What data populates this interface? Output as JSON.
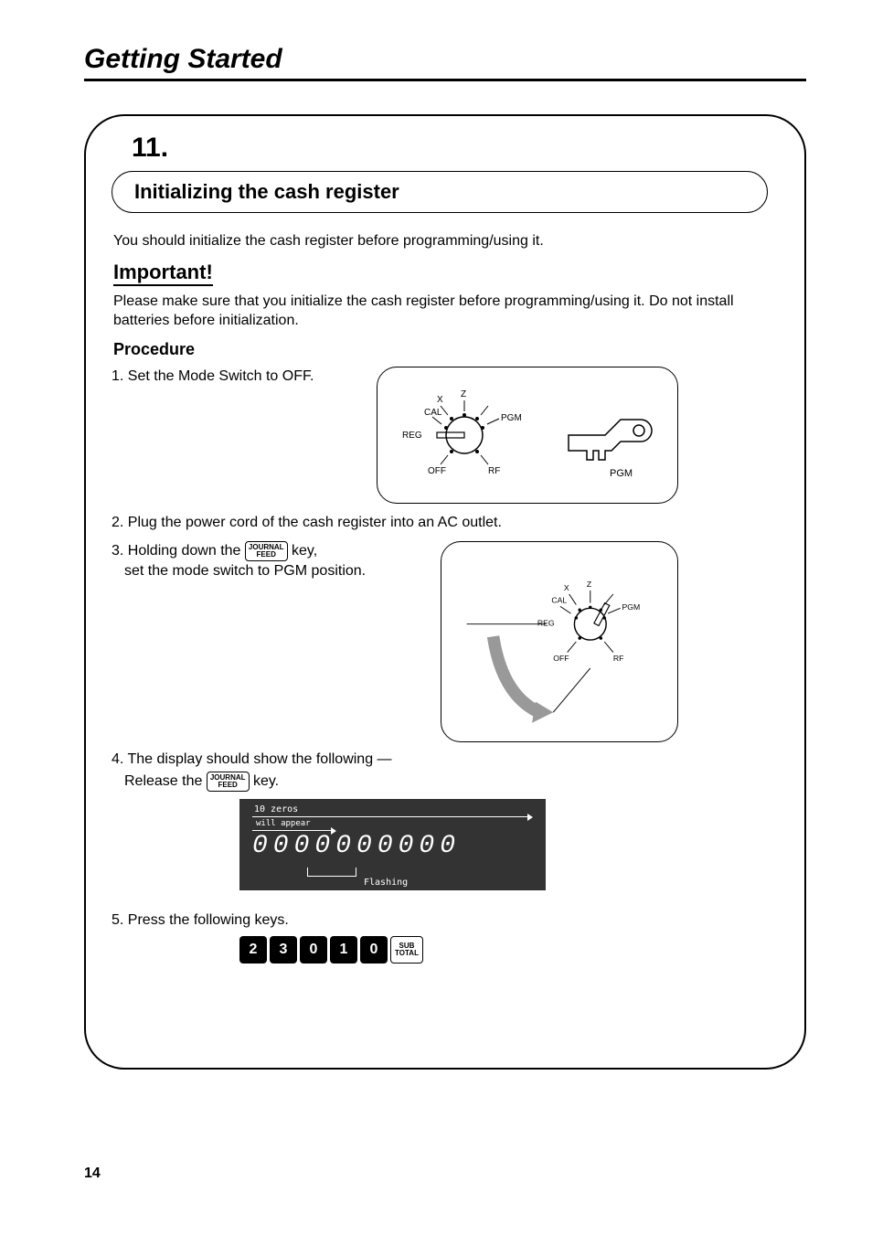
{
  "page_title": "Getting Started",
  "step_heading": "11.",
  "pill_text": "Initializing the cash register",
  "intro": "You should initialize the cash register before programming/using it.",
  "important_label": "Important!",
  "important_text": "Please make sure that you initialize the cash register before programming/using it. Do not install batteries before initialization.",
  "procedure_label": "Procedure",
  "step1_label": "1.",
  "step1_text": "Set the Mode Switch to OFF.",
  "dial1": {
    "label_top_left": "CAL",
    "label_top_mid": "X",
    "label_top_right": "Z",
    "label_left": "REG",
    "label_right": "PGM",
    "label_bottom_left": "OFF",
    "label_bottom_right": "RF",
    "key_label": "PGM"
  },
  "step2_label": "2.",
  "step2_text": "Plug the power cord of the cash register into an AC outlet.",
  "step3_label": "3.",
  "step3_text_a": "Holding down the ",
  "journal_key": {
    "line1": "JOURNAL",
    "line2": "FEED"
  },
  "step3_text_b": " key,",
  "step3_text_c": "set the mode switch to PGM position.",
  "dial2": {
    "label_top_left": "CAL",
    "label_top_mid": "X",
    "label_top_right": "Z",
    "label_left": "REG",
    "label_right": "PGM",
    "label_bottom_left": "OFF",
    "label_bottom_right": "RF"
  },
  "step4_label": "4.",
  "step4_text_a": "The display should show the following —",
  "step4_text_b": "Release the ",
  "step4_text_c": " key.",
  "display": {
    "top_label": "10 zeros",
    "sub_label": "will appear",
    "zeros": "0000000000",
    "flash": "Flashing"
  },
  "step5_label": "5.",
  "step5_text": "Press the following keys.",
  "keys": [
    "2",
    "3",
    "0",
    "1",
    "0"
  ],
  "subtotal_key": {
    "line1": "SUB",
    "line2": "TOTAL"
  },
  "page_number": "14"
}
